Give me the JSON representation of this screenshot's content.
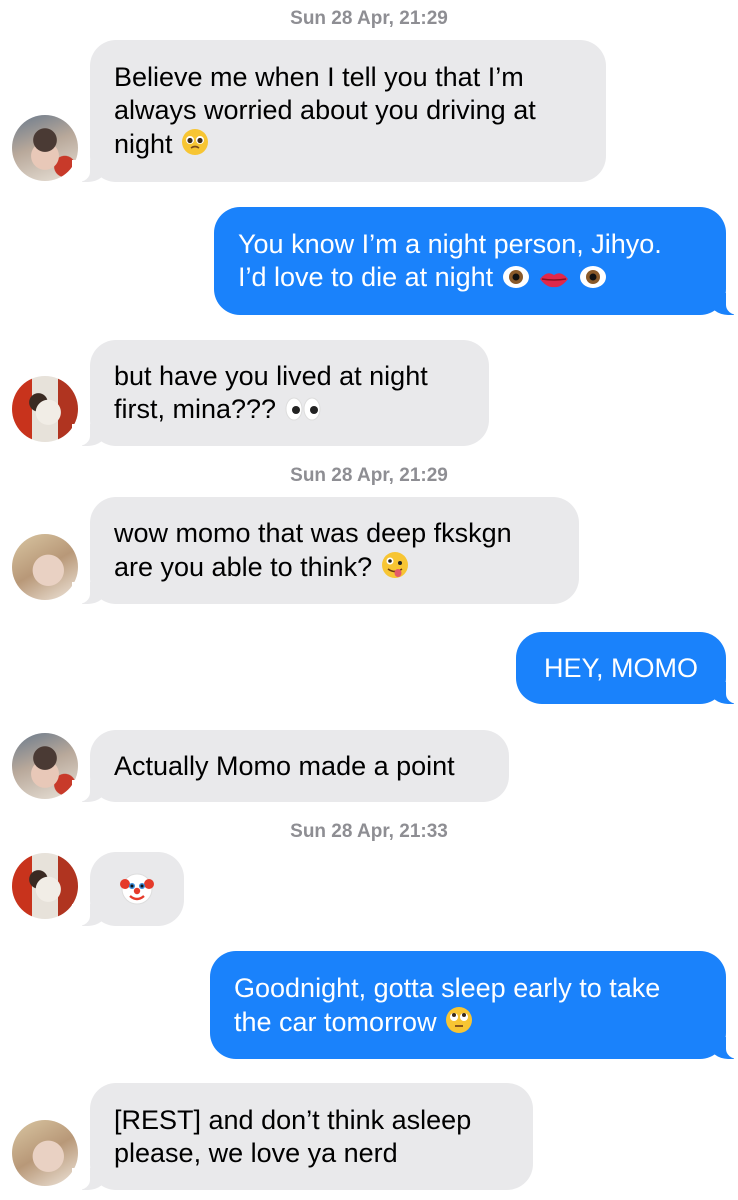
{
  "timestamps": [
    {
      "day": "Sun 28 Apr,",
      "time": "21:29"
    },
    {
      "day": "Sun 28 Apr,",
      "time": "21:29"
    },
    {
      "day": "Sun 28 Apr,",
      "time": "21:33"
    }
  ],
  "messages": [
    {
      "from": "incoming",
      "sender_avatar": "avatar-a",
      "lines": [
        "Believe me when I tell you that I’m",
        "always worried about you driving at",
        "night"
      ],
      "emoji": [
        "pleading-face-icon"
      ]
    },
    {
      "from": "outgoing",
      "lines": [
        "You know I’m a night person, Jihyo.",
        "I’d love to die at night"
      ],
      "emoji": [
        "eye-icon",
        "lips-icon",
        "eye-icon"
      ]
    },
    {
      "from": "incoming",
      "sender_avatar": "avatar-b",
      "lines": [
        "but have you lived at night",
        "first, mina???"
      ],
      "emoji": [
        "eyes-icon"
      ]
    },
    {
      "from": "incoming",
      "sender_avatar": "avatar-c",
      "lines": [
        "wow momo that was deep fkskgn",
        "are you able to think?"
      ],
      "emoji": [
        "zany-face-icon"
      ]
    },
    {
      "from": "outgoing",
      "lines": [
        "HEY, MOMO"
      ]
    },
    {
      "from": "incoming",
      "sender_avatar": "avatar-a",
      "lines": [
        "Actually Momo made a point"
      ]
    },
    {
      "from": "incoming",
      "sender_avatar": "avatar-b",
      "lines": [],
      "emoji": [
        "clown-face-icon"
      ]
    },
    {
      "from": "outgoing",
      "lines": [
        "Goodnight, gotta sleep early to take",
        "the car tomorrow"
      ],
      "emoji": [
        "eye-roll-face-icon"
      ]
    },
    {
      "from": "incoming",
      "sender_avatar": "avatar-c",
      "lines": [
        "[REST] and don’t think asleep",
        "please, we love ya nerd"
      ]
    }
  ],
  "colors": {
    "incoming_bubble": "#e9e9eb",
    "outgoing_bubble": "#1a82fb",
    "timestamp": "#8e8e93"
  }
}
